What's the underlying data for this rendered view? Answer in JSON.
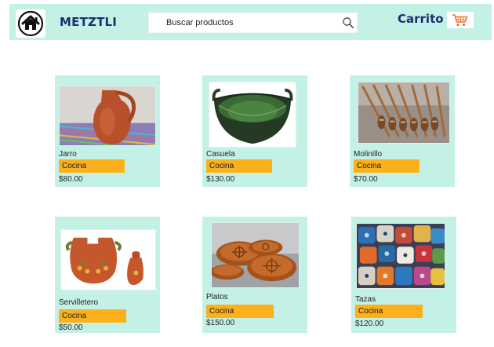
{
  "header": {
    "brand": "METZTLI",
    "home_icon": "home-icon",
    "search": {
      "placeholder": "Buscar productos",
      "value": "",
      "icon": "search-icon"
    },
    "cart_label": "Carrito",
    "cart_icon": "shopping-cart-icon"
  },
  "colors": {
    "mint": "#c4f1e5",
    "navy": "#1b2f73",
    "orange": "#fcb11c"
  },
  "products": [
    {
      "name": "Jarro",
      "category": "Cocina",
      "price": "$80.00"
    },
    {
      "name": "Casuela",
      "category": "Cocina",
      "price": "$130.00"
    },
    {
      "name": "Molinillo",
      "category": "Cocina",
      "price": "$70.00"
    },
    {
      "name": "Servilletero",
      "category": "Cocina",
      "price": "$50.00"
    },
    {
      "name": "Platos",
      "category": "Cocina",
      "price": "$150.00"
    },
    {
      "name": "Tazas",
      "category": "Cocina",
      "price": "$120.00"
    }
  ]
}
